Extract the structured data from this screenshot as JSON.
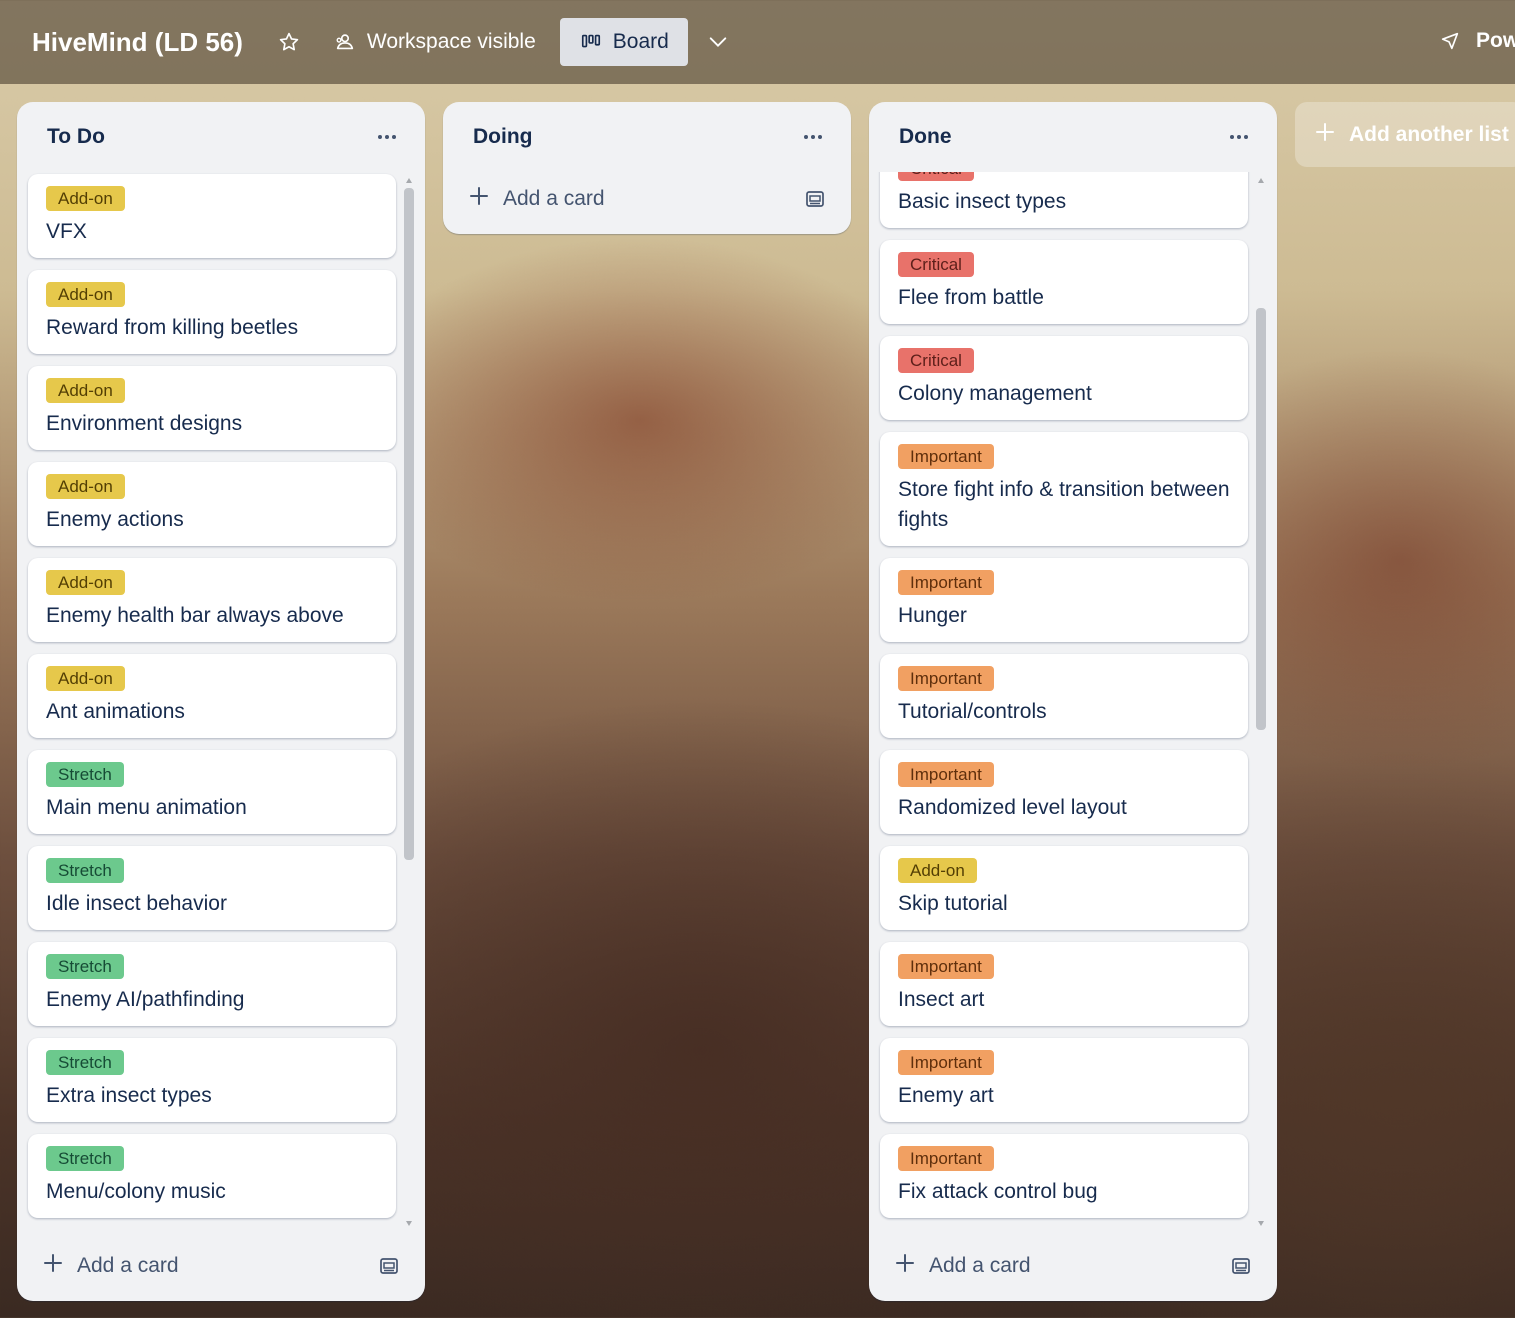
{
  "board": {
    "title": "HiveMind (LD 56)",
    "visibility": "Workspace visible",
    "view": "Board",
    "power_ups": "Pow"
  },
  "lists": [
    {
      "title": "To Do",
      "add_card": "Add a card",
      "cards": [
        {
          "label": "Add-on",
          "title": "VFX"
        },
        {
          "label": "Add-on",
          "title": "Reward from killing beetles"
        },
        {
          "label": "Add-on",
          "title": "Environment designs"
        },
        {
          "label": "Add-on",
          "title": "Enemy actions"
        },
        {
          "label": "Add-on",
          "title": "Enemy health bar always above"
        },
        {
          "label": "Add-on",
          "title": "Ant animations"
        },
        {
          "label": "Stretch",
          "title": "Main menu animation"
        },
        {
          "label": "Stretch",
          "title": "Idle insect behavior"
        },
        {
          "label": "Stretch",
          "title": "Enemy AI/pathfinding"
        },
        {
          "label": "Stretch",
          "title": "Extra insect types"
        },
        {
          "label": "Stretch",
          "title": "Menu/colony music"
        }
      ]
    },
    {
      "title": "Doing",
      "add_card": "Add a card",
      "cards": []
    },
    {
      "title": "Done",
      "add_card": "Add a card",
      "cards": [
        {
          "label": "Critical",
          "title": "Basic insect types"
        },
        {
          "label": "Critical",
          "title": "Flee from battle"
        },
        {
          "label": "Critical",
          "title": "Colony management"
        },
        {
          "label": "Important",
          "title": "Store fight info & transition between fights"
        },
        {
          "label": "Important",
          "title": "Hunger"
        },
        {
          "label": "Important",
          "title": "Tutorial/controls"
        },
        {
          "label": "Important",
          "title": "Randomized level layout"
        },
        {
          "label": "Add-on",
          "title": "Skip tutorial"
        },
        {
          "label": "Important",
          "title": "Insect art"
        },
        {
          "label": "Important",
          "title": "Enemy art"
        },
        {
          "label": "Important",
          "title": "Fix attack control bug"
        }
      ]
    }
  ],
  "add_list": "Add another list",
  "label_colors": {
    "Add-on": "#e6c84b",
    "Stretch": "#6cc98d",
    "Critical": "#e8726a",
    "Important": "#f1a062"
  }
}
